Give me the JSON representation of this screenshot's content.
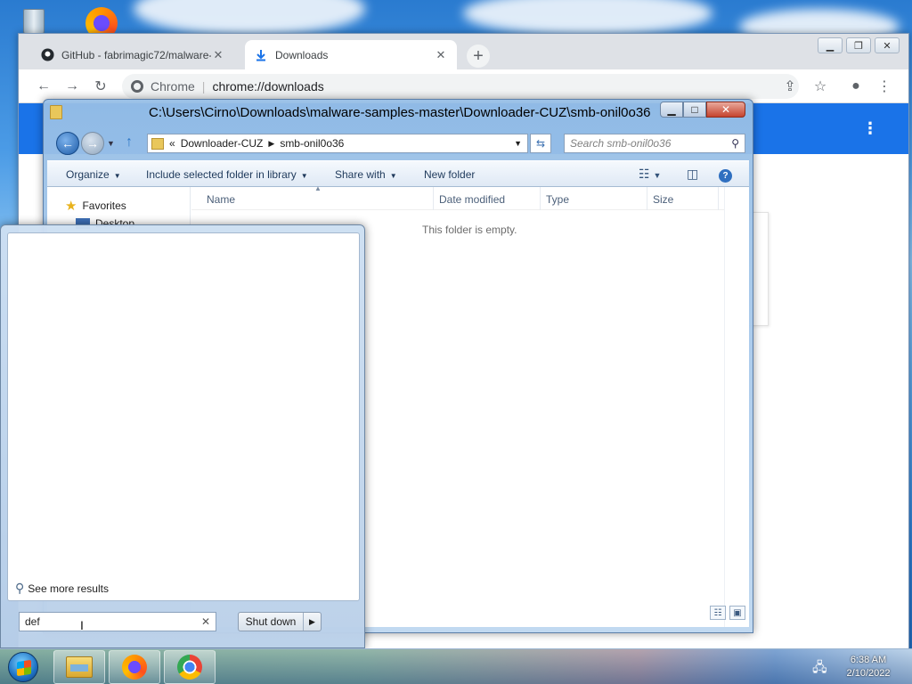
{
  "browser": {
    "tabs": [
      {
        "label": "GitHub - fabrimagic72/malware-",
        "icon": "github-icon"
      },
      {
        "label": "Downloads",
        "icon": "download-icon"
      }
    ],
    "omnibox": {
      "site": "Chrome",
      "url": "chrome://downloads"
    }
  },
  "explorer": {
    "title": "C:\\Users\\Cirno\\Downloads\\malware-samples-master\\Downloader-CUZ\\smb-onil0o36",
    "breadcrumbs": [
      "«",
      "Downloader-CUZ",
      "smb-onil0o36"
    ],
    "search_placeholder": "Search smb-onil0o36",
    "commands": {
      "organize": "Organize",
      "include": "Include selected folder in library",
      "share": "Share with",
      "new_folder": "New folder"
    },
    "nav": {
      "favorites": "Favorites",
      "desktop": "Desktop"
    },
    "columns": [
      "Name",
      "Date modified",
      "Type",
      "Size"
    ],
    "empty_message": "This folder is empty."
  },
  "start_menu": {
    "see_more": "See more results",
    "search_value": "def",
    "shutdown_label": "Shut down"
  },
  "taskbar": {
    "time": "6:38 AM",
    "date": "2/10/2022"
  }
}
